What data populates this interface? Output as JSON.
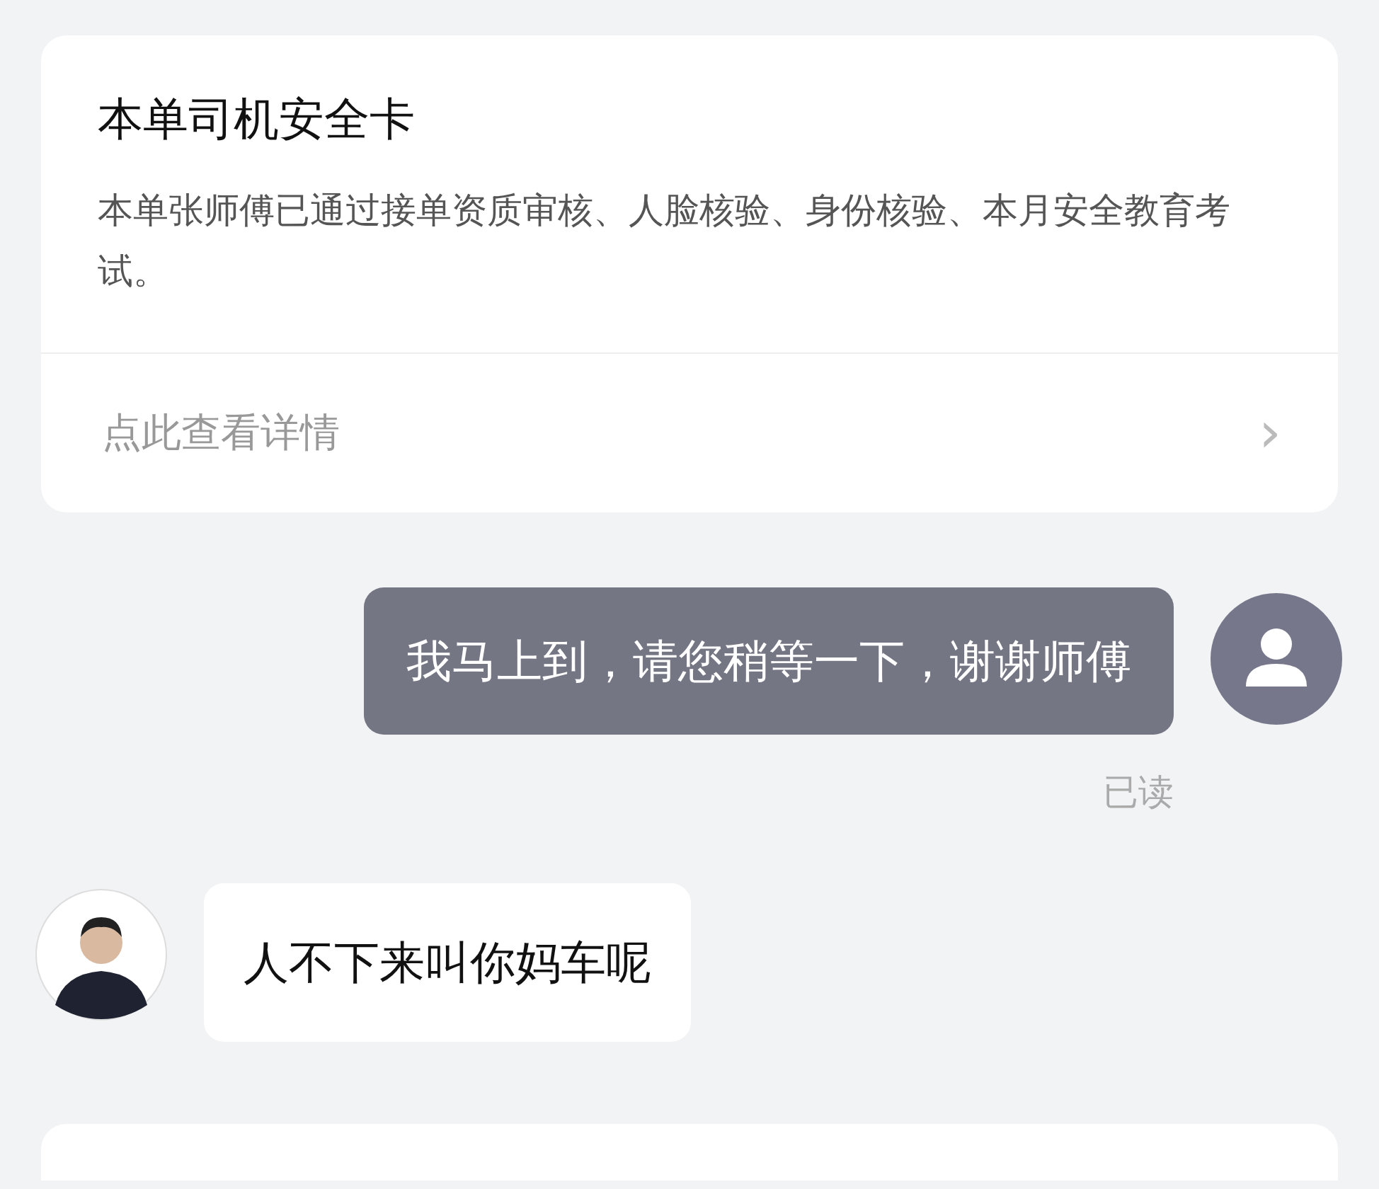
{
  "safety_card": {
    "title": "本单司机安全卡",
    "description": "本单张师傅已通过接单资质审核、人脸核验、身份核验、本月安全教育考试。",
    "link": "点此查看详情",
    "chevron": "›"
  },
  "messages": [
    {
      "kind": "sent",
      "text": "我马上到，请您稍等一下，谢谢师傅",
      "status": "已读"
    },
    {
      "kind": "received",
      "text": "人不下来叫你妈车呢"
    }
  ]
}
